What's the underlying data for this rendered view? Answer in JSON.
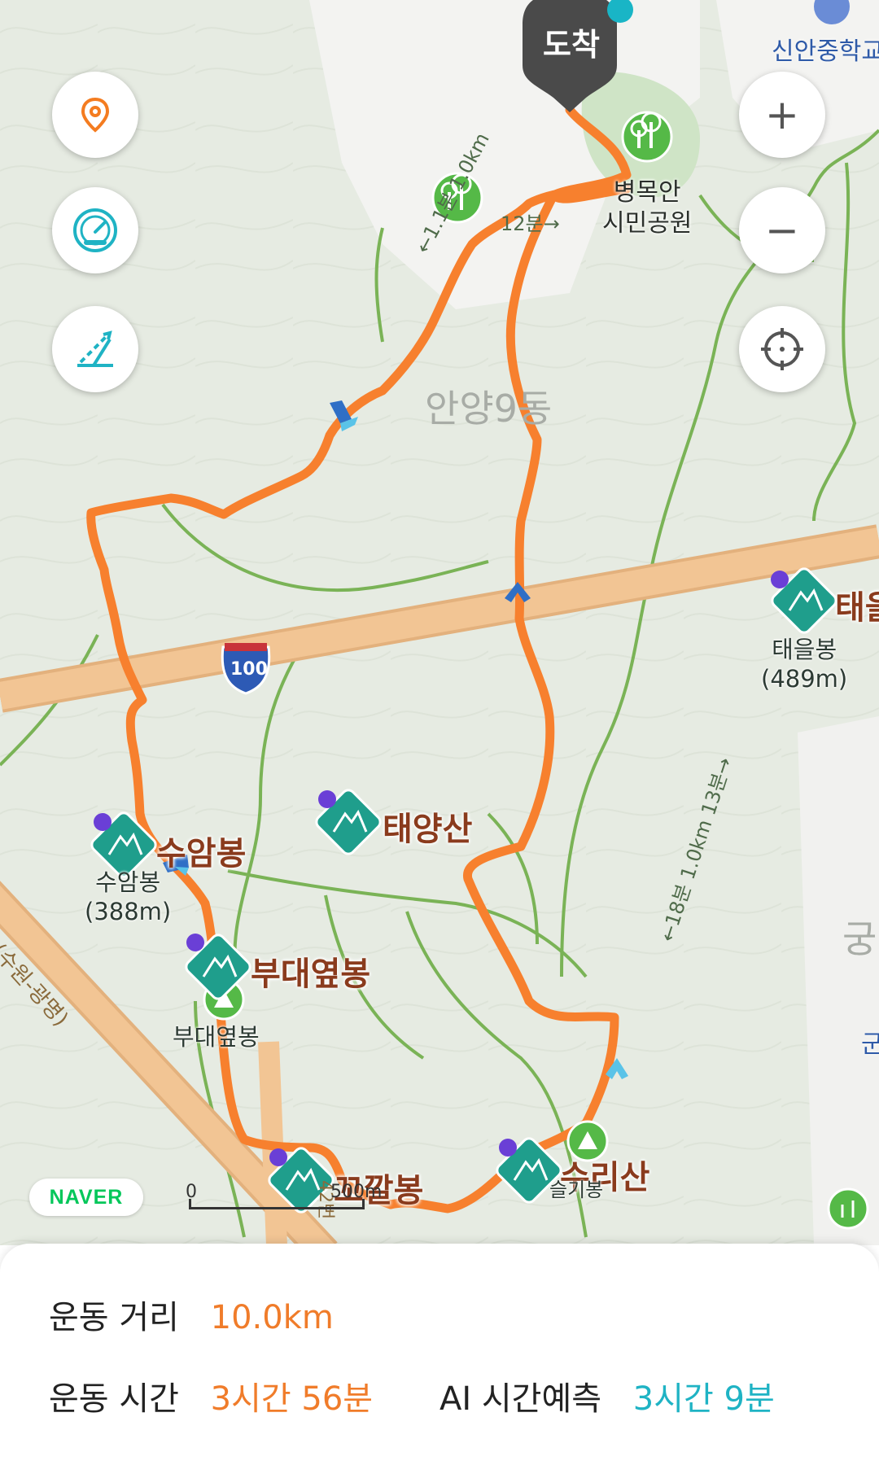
{
  "map": {
    "arrival_label": "도착",
    "school_label": "신안중학교",
    "park_label_line1": "병목안",
    "park_label_line2": "시민공원",
    "district_label": "안양9동",
    "trail_note_top": "←1.1분 1.0km",
    "trail_note_right": "←18분 1.0km 13분→",
    "trail_note_small": "12분→",
    "highway_shield": "100",
    "diagonal_road_label": "(수원-광명)",
    "vertical_road_label": "42번",
    "district_partial_right": "궁",
    "district_partial_right2": "군",
    "peaks": [
      {
        "name": "태을",
        "sub1": "태을봉",
        "sub2": "(489m)"
      },
      {
        "name": "태양산"
      },
      {
        "name": "수암봉",
        "sub1": "수암봉",
        "sub2": "(388m)"
      },
      {
        "name": "부대옆봉",
        "sub1": "부대옆봉"
      },
      {
        "name": "꼬깔봉"
      },
      {
        "name": "수리산",
        "sub1": "슬기봉"
      }
    ],
    "naver_logo": "NAVER",
    "scale_zero": "0",
    "scale_distance": "500m",
    "route_color": "#f7802e",
    "trail_color": "#7ab356",
    "road_color": "#f2c594",
    "peak_icon_color": "#1f9e8c"
  },
  "controls": {
    "location_icon": "location-pin-icon",
    "speed_icon": "speedometer-icon",
    "slope_icon": "slope-icon",
    "zoom_in": "+",
    "zoom_out": "−",
    "locate_icon": "crosshair-icon"
  },
  "stats": {
    "distance_label": "운동 거리",
    "distance_value": "10.0km",
    "time_label": "운동 시간",
    "time_value": "3시간 56분",
    "ai_label": "AI 시간예측",
    "ai_value": "3시간 9분"
  }
}
